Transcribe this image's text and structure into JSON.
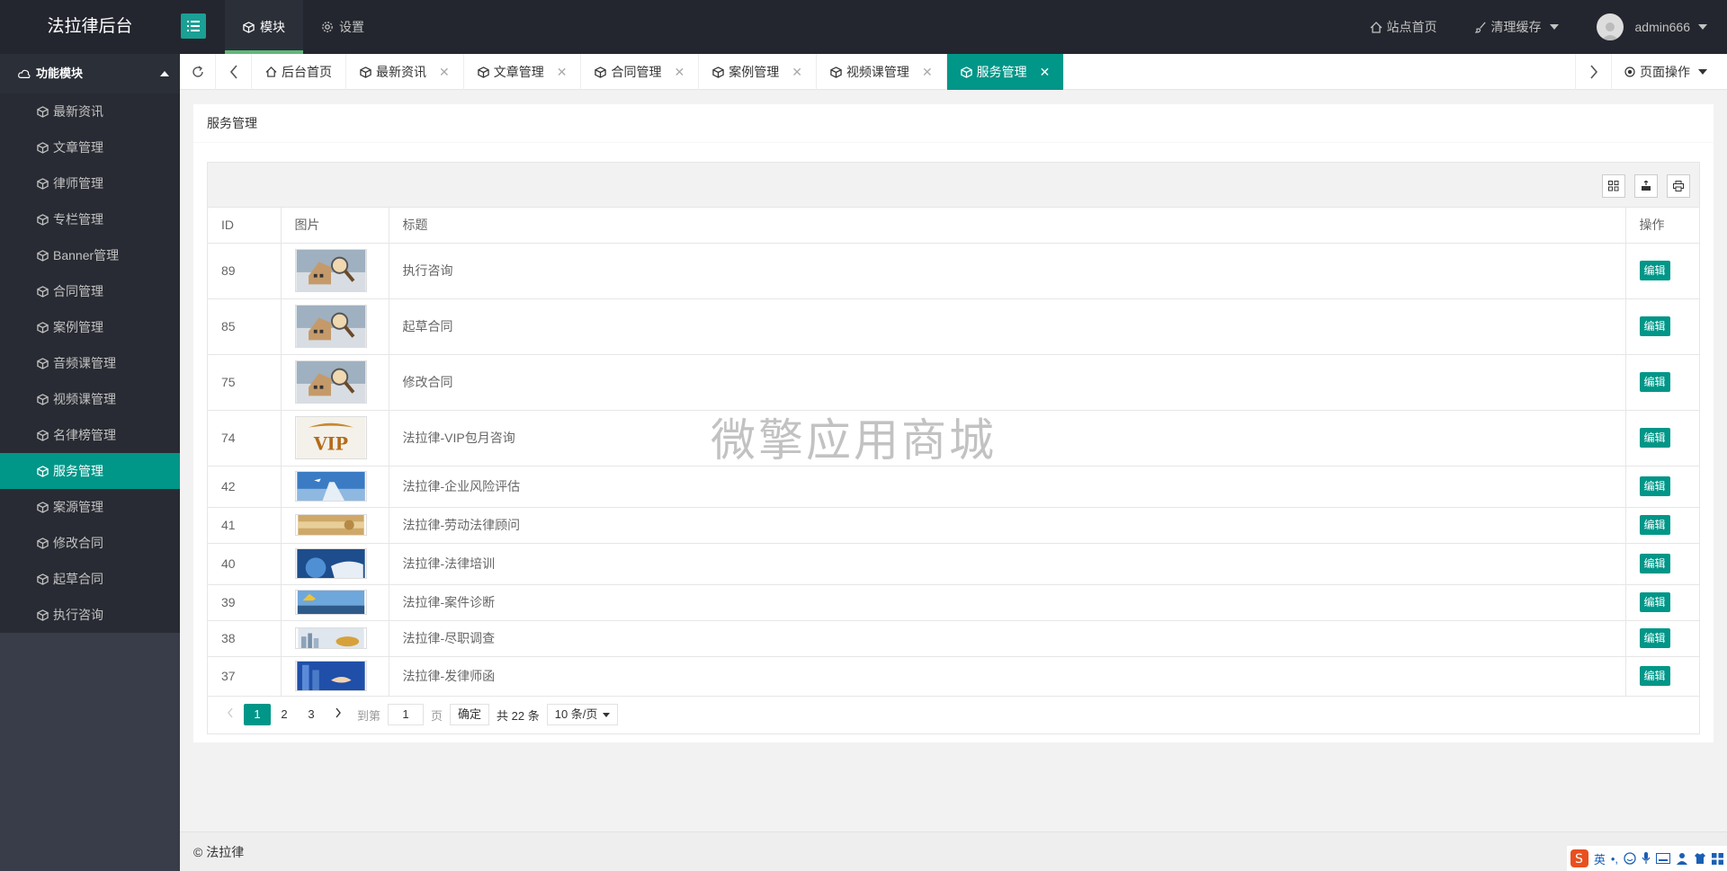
{
  "app": {
    "logo": "法拉律后台"
  },
  "top_nav": [
    {
      "label": "模块",
      "icon": "cube-icon",
      "active": true
    },
    {
      "label": "设置",
      "icon": "gear-icon",
      "active": false
    }
  ],
  "top_right": {
    "home": "站点首页",
    "cache": "清理缓存",
    "user": "admin666"
  },
  "sidebar": {
    "section": "功能模块",
    "items": [
      {
        "label": "最新资讯"
      },
      {
        "label": "文章管理"
      },
      {
        "label": "律师管理"
      },
      {
        "label": "专栏管理"
      },
      {
        "label": "Banner管理"
      },
      {
        "label": "合同管理"
      },
      {
        "label": "案例管理"
      },
      {
        "label": "音频课管理"
      },
      {
        "label": "视频课管理"
      },
      {
        "label": "名律榜管理"
      },
      {
        "label": "服务管理",
        "active": true
      },
      {
        "label": "案源管理"
      },
      {
        "label": "修改合同"
      },
      {
        "label": "起草合同"
      },
      {
        "label": "执行咨询"
      }
    ]
  },
  "tabs": [
    {
      "label": "后台首页",
      "icon": "home-icon",
      "closable": false
    },
    {
      "label": "最新资讯",
      "closable": true
    },
    {
      "label": "文章管理",
      "closable": true
    },
    {
      "label": "合同管理",
      "closable": true
    },
    {
      "label": "案例管理",
      "closable": true
    },
    {
      "label": "视频课管理",
      "closable": true
    },
    {
      "label": "服务管理",
      "closable": true,
      "active": true
    }
  ],
  "page_ops": "页面操作",
  "card": {
    "title": "服务管理"
  },
  "table": {
    "columns": [
      "ID",
      "图片",
      "标题",
      "操作"
    ],
    "rows": [
      {
        "id": "89",
        "title": "执行咨询",
        "image": "house-magnifier"
      },
      {
        "id": "85",
        "title": "起草合同",
        "image": "house-magnifier"
      },
      {
        "id": "75",
        "title": "修改合同",
        "image": "house-magnifier"
      },
      {
        "id": "74",
        "title": "法拉律-VIP包月咨询",
        "image": "vip-badge"
      },
      {
        "id": "42",
        "title": "法拉律-企业风险评估",
        "image": "sky-road"
      },
      {
        "id": "41",
        "title": "法拉律-劳动法律顾问",
        "image": "gold-banner"
      },
      {
        "id": "40",
        "title": "法拉律-法律培训",
        "image": "globe-hands"
      },
      {
        "id": "39",
        "title": "法拉律-案件诊断",
        "image": "city-sky"
      },
      {
        "id": "38",
        "title": "法拉律-尽职调查",
        "image": "skyline-gold"
      },
      {
        "id": "37",
        "title": "法拉律-发律师函",
        "image": "handshake-blue"
      }
    ],
    "edit_label": "编辑"
  },
  "pager": {
    "pages": [
      "1",
      "2",
      "3"
    ],
    "goto_label": "到第",
    "goto_value": "1",
    "page_unit": "页",
    "confirm": "确定",
    "total": "共 22 条",
    "per_page": "10 条/页"
  },
  "footer": "© 法拉律",
  "watermark": "微擎应用商城",
  "ime": {
    "lang": "英"
  },
  "colors": {
    "primary": "#009688",
    "header": "#23262e",
    "sidebar": "#393d49",
    "sidebar_list": "#282b33"
  }
}
